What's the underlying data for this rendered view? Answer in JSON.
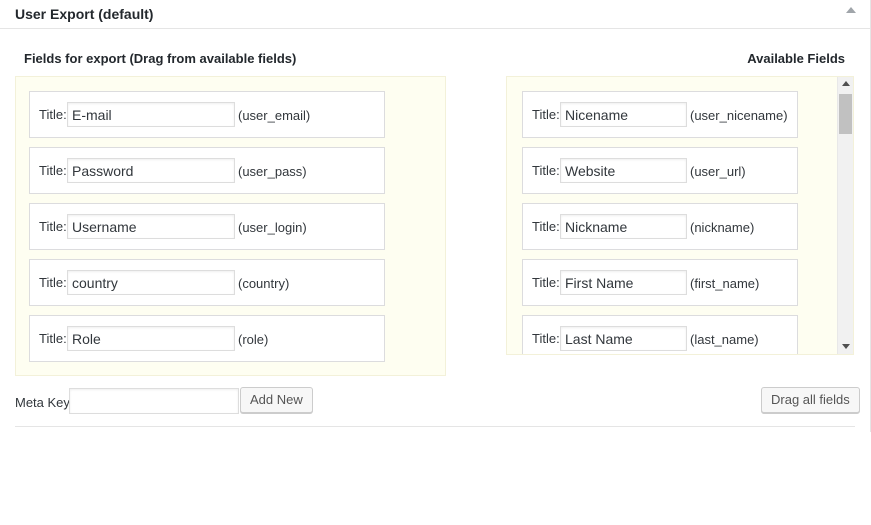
{
  "panel": {
    "title": "User Export (default)"
  },
  "headings": {
    "left": "Fields for export (Drag from available fields)",
    "right": "Available Fields"
  },
  "title_prefix": "Title:",
  "export_fields": [
    {
      "title": "E-mail",
      "key": "(user_email)"
    },
    {
      "title": "Password",
      "key": "(user_pass)"
    },
    {
      "title": "Username",
      "key": "(user_login)"
    },
    {
      "title": "country",
      "key": "(country)"
    },
    {
      "title": "Role",
      "key": "(role)"
    }
  ],
  "available_fields": [
    {
      "title": "Nicename",
      "key": "(user_nicename)"
    },
    {
      "title": "Website",
      "key": "(user_url)"
    },
    {
      "title": "Nickname",
      "key": "(nickname)"
    },
    {
      "title": "First Name",
      "key": "(first_name)"
    },
    {
      "title": "Last Name",
      "key": "(last_name)"
    }
  ],
  "meta": {
    "label": "Meta Key",
    "value": "",
    "add_button": "Add New"
  },
  "drag_all_button": "Drag all fields"
}
